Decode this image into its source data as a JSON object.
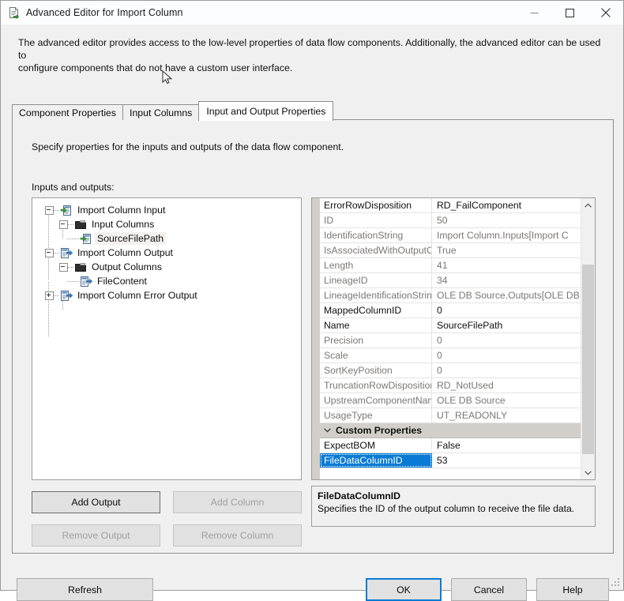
{
  "window": {
    "title": "Advanced Editor for Import Column",
    "icon": "document-arrow-icon",
    "minimize_label": "Minimize",
    "maximize_label": "Maximize",
    "close_label": "Close"
  },
  "intro": {
    "line1": "The advanced editor provides access to the low-level properties of data flow components. Additionally, the advanced editor can be used to",
    "line2": "configure components that do not have a custom user interface."
  },
  "tabs": [
    {
      "label": "Component Properties",
      "selected": false
    },
    {
      "label": "Input Columns",
      "selected": false
    },
    {
      "label": "Input and Output Properties",
      "selected": true
    }
  ],
  "page": {
    "description": "Specify properties for the inputs and outputs of the data flow component.",
    "tree_label": "Inputs and outputs:"
  },
  "tree": [
    {
      "label": "Import Column Input",
      "icon": "input-icon",
      "expander": "minus",
      "depth": 0,
      "selected": false
    },
    {
      "label": "Input Columns",
      "icon": "folder-icon",
      "expander": "minus",
      "depth": 1,
      "selected": false
    },
    {
      "label": "SourceFilePath",
      "icon": "input-icon",
      "expander": "none",
      "depth": 2,
      "selected": true
    },
    {
      "label": "Import Column Output",
      "icon": "output-icon",
      "expander": "minus",
      "depth": 0,
      "selected": false
    },
    {
      "label": "Output Columns",
      "icon": "folder-icon",
      "expander": "minus",
      "depth": 1,
      "selected": false
    },
    {
      "label": "FileContent",
      "icon": "output-icon",
      "expander": "none",
      "depth": 2,
      "selected": false
    },
    {
      "label": "Import Column Error Output",
      "icon": "output-icon",
      "expander": "plus",
      "depth": 0,
      "selected": false
    }
  ],
  "grid": {
    "rows": [
      {
        "name": "ErrorRowDisposition",
        "value": "RD_FailComponent",
        "editable": true,
        "category": false,
        "selected": false
      },
      {
        "name": "ID",
        "value": "50",
        "editable": false,
        "category": false,
        "selected": false
      },
      {
        "name": "IdentificationString",
        "value": "Import Column.Inputs[Import C",
        "editable": false,
        "category": false,
        "selected": false
      },
      {
        "name": "IsAssociatedWithOutputCo",
        "value": "True",
        "editable": false,
        "category": false,
        "selected": false
      },
      {
        "name": "Length",
        "value": "41",
        "editable": false,
        "category": false,
        "selected": false
      },
      {
        "name": "LineageID",
        "value": "34",
        "editable": false,
        "category": false,
        "selected": false
      },
      {
        "name": "LineageIdentificationString",
        "value": "OLE DB Source.Outputs[OLE DB",
        "editable": false,
        "category": false,
        "selected": false
      },
      {
        "name": "MappedColumnID",
        "value": "0",
        "editable": true,
        "category": false,
        "selected": false
      },
      {
        "name": "Name",
        "value": "SourceFilePath",
        "editable": true,
        "category": false,
        "selected": false
      },
      {
        "name": "Precision",
        "value": "0",
        "editable": false,
        "category": false,
        "selected": false
      },
      {
        "name": "Scale",
        "value": "0",
        "editable": false,
        "category": false,
        "selected": false
      },
      {
        "name": "SortKeyPosition",
        "value": "0",
        "editable": false,
        "category": false,
        "selected": false
      },
      {
        "name": "TruncationRowDisposition",
        "value": "RD_NotUsed",
        "editable": false,
        "category": false,
        "selected": false
      },
      {
        "name": "UpstreamComponentName",
        "value": "OLE DB Source",
        "editable": false,
        "category": false,
        "selected": false
      },
      {
        "name": "UsageType",
        "value": "UT_READONLY",
        "editable": false,
        "category": false,
        "selected": false
      },
      {
        "name": "Custom Properties",
        "value": "",
        "editable": true,
        "category": true,
        "selected": false
      },
      {
        "name": "ExpectBOM",
        "value": "False",
        "editable": true,
        "category": false,
        "selected": false
      },
      {
        "name": "FileDataColumnID",
        "value": "53",
        "editable": true,
        "category": false,
        "selected": true
      }
    ],
    "scroll_up_icon": "chevron-up-icon",
    "scroll_down_icon": "chevron-down-icon"
  },
  "description_pane": {
    "title": "FileDataColumnID",
    "text": "Specifies the ID of the output column to receive the file data."
  },
  "column_buttons": {
    "add_output": "Add Output",
    "add_column": "Add Column",
    "remove_output": "Remove Output",
    "remove_column": "Remove Column"
  },
  "footer": {
    "refresh": "Refresh",
    "ok": "OK",
    "cancel": "Cancel",
    "help": "Help"
  },
  "colors": {
    "accent": "#0a7bd4",
    "selection": "#0a7bd4",
    "dialog_bg": "#f0f0f0",
    "grid_category_bg": "#d2cfca",
    "disabled_text": "#a0a0a0",
    "readonly_text": "#7b7876"
  }
}
